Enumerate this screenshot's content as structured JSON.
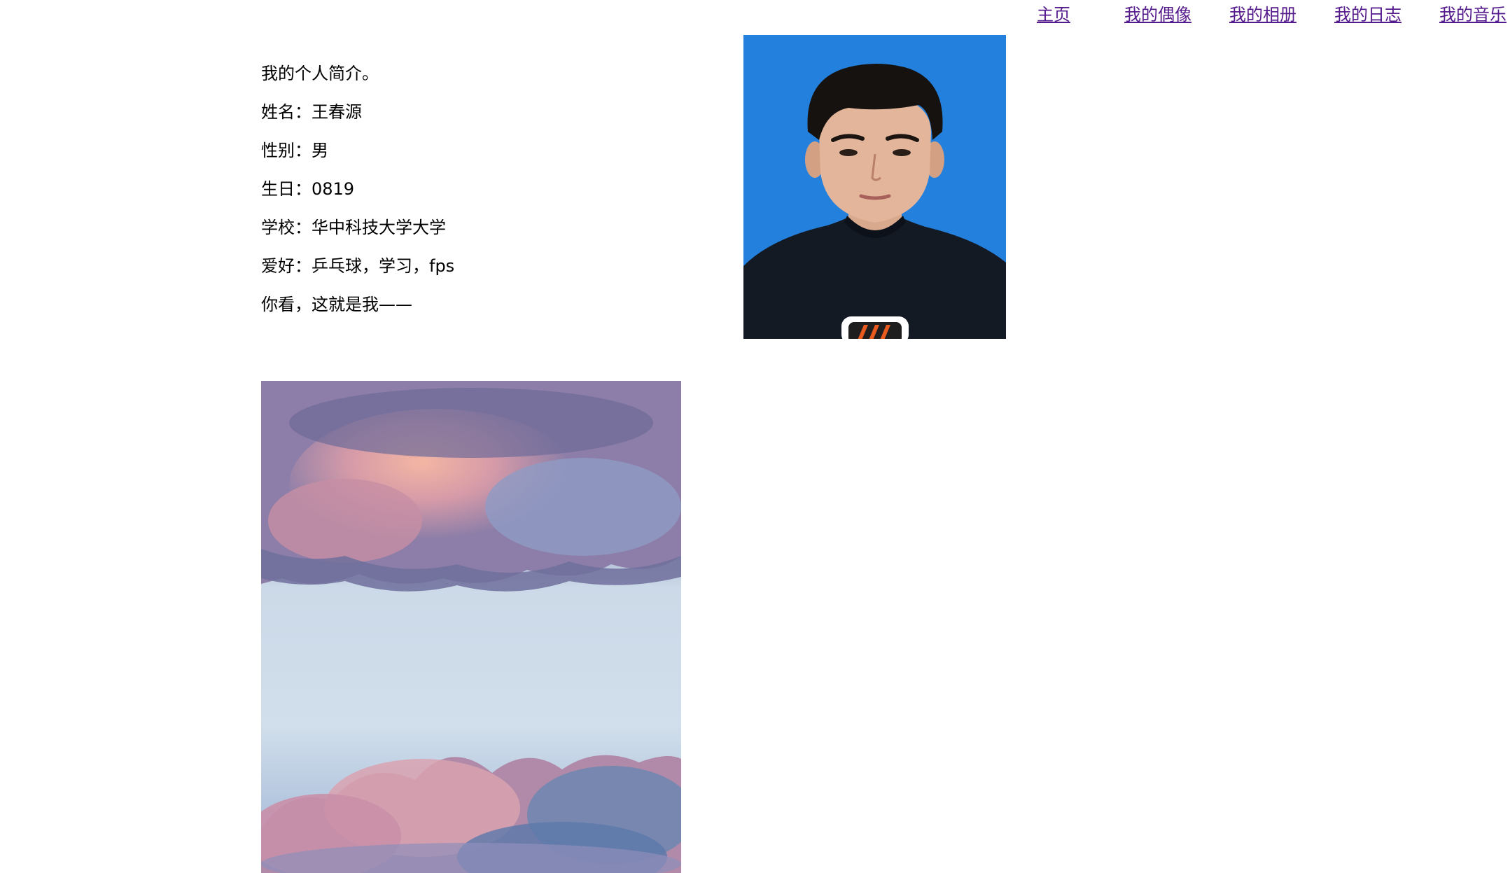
{
  "nav": {
    "home": "主页",
    "idol": "我的偶像",
    "album": "我的相册",
    "diary": "我的日志",
    "music": "我的音乐"
  },
  "intro": {
    "heading": "我的个人简介。",
    "name": "姓名：王春源",
    "gender": "性别：男",
    "birthday": "生日：0819",
    "school": "学校：华中科技大学大学",
    "hobbies": "爱好：乒乓球，学习，fps",
    "look": "你看，这就是我——"
  },
  "colors": {
    "link": "#551a8b",
    "portrait_background": "#2480dd",
    "shirt": "#141a24"
  },
  "images": {
    "portrait": "portrait-photo",
    "sky": "sky-clouds-photo"
  }
}
